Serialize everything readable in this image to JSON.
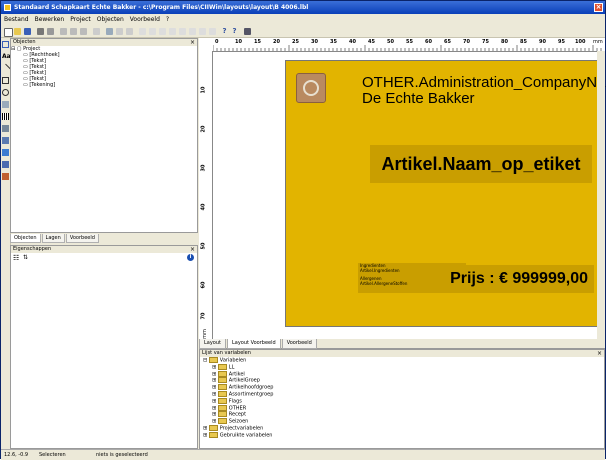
{
  "window": {
    "title": "Standaard Schapkaart Echte Bakker - c:\\Program Files\\CIIWin\\layouts\\layout\\B 4006.lbl"
  },
  "menu": [
    "Bestand",
    "Bewerken",
    "Project",
    "Objecten",
    "Voorbeeld",
    "?"
  ],
  "objects_panel": {
    "title": "Objecten",
    "tree": [
      "Project",
      "[Rechthoek]",
      "[Tekst]",
      "[Tekst]",
      "[Tekst]",
      "[Tekst]",
      "[Tekening]"
    ]
  },
  "objects_tabs": [
    "Objecten",
    "Lagen",
    "Voorbeeld"
  ],
  "properties_panel": {
    "title": "Eigenschappen"
  },
  "ruler": {
    "h_labels": [
      "0",
      "10",
      "15",
      "20",
      "25",
      "30",
      "35",
      "40",
      "45",
      "50",
      "55",
      "60",
      "65",
      "70",
      "75",
      "80",
      "85",
      "90",
      "95",
      "100",
      "mm"
    ],
    "v_labels": [
      "10",
      "20",
      "30",
      "40",
      "50",
      "60",
      "70",
      "mm"
    ]
  },
  "label": {
    "company_line1": "OTHER.Administration_CompanyName",
    "company_line2": "De Echte Bakker",
    "article": "Artikel.Naam_op_etiket",
    "ingredients_title": "Ingredienten",
    "ingredients_value": "Artikel.Ingredienten",
    "allergens_title": "Allergenen",
    "allergens_value": "Artikel.AllergeneStoffen",
    "price": "Prijs : € 999999,00"
  },
  "bottom_tabs": [
    "Layout",
    "Layout Voorbeeld",
    "Voorbeeld"
  ],
  "variables_panel": {
    "title": "Lijst van variabelen",
    "tree": [
      "Variabelen",
      "LL",
      "Artikel",
      "ArtikelGroep",
      "Artikelhoofdgroep",
      "Assortimentgroep",
      "Flags",
      "OTHER",
      "Recept",
      "Seizoen",
      "Projectvariabelen",
      "Gebruikte variabelen"
    ]
  },
  "status": {
    "coords": "12.6, -0.9",
    "mode": "Selecteren",
    "selection": "niets is geselecteerd"
  },
  "colors": {
    "label_bg": "#e2b400",
    "label_box": "#c99e00",
    "title_bar": "#0a3fb8"
  }
}
